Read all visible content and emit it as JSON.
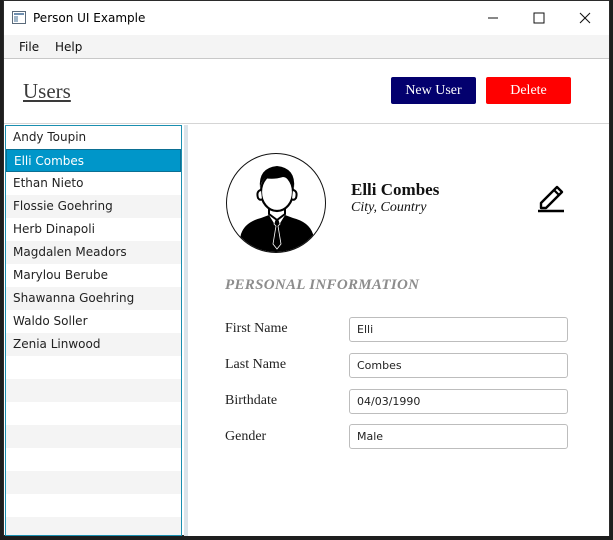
{
  "window": {
    "title": "Person UI Example",
    "controls": {
      "minimize": "minimize-icon",
      "maximize": "maximize-icon",
      "close": "close-icon"
    }
  },
  "menu": {
    "file": "File",
    "help": "Help"
  },
  "header": {
    "title": "Users",
    "new_user_label": "New User",
    "delete_label": "Delete",
    "colors": {
      "new_user": "#03006e",
      "delete": "#ff0000"
    }
  },
  "users": [
    "Andy Toupin",
    "Elli Combes",
    "Ethan Nieto",
    "Flossie Goehring",
    "Herb Dinapoli",
    "Magdalen Meadors",
    "Marylou Berube",
    "Shawanna Goehring",
    "Waldo Soller",
    "Zenia Linwood"
  ],
  "selected_user": "Elli Combes",
  "selection_color": "#0096c9",
  "detail": {
    "name": "Elli Combes",
    "location": "City, Country",
    "avatar_icon": "person-avatar-icon",
    "edit_icon": "pencil-icon",
    "section_title": "PERSONAL INFORMATION",
    "fields": {
      "first_name": {
        "label": "First Name",
        "value": "Elli"
      },
      "last_name": {
        "label": "Last Name",
        "value": "Combes"
      },
      "birthdate": {
        "label": "Birthdate",
        "value": "04/03/1990"
      },
      "gender": {
        "label": "Gender",
        "value": "Male"
      }
    }
  }
}
